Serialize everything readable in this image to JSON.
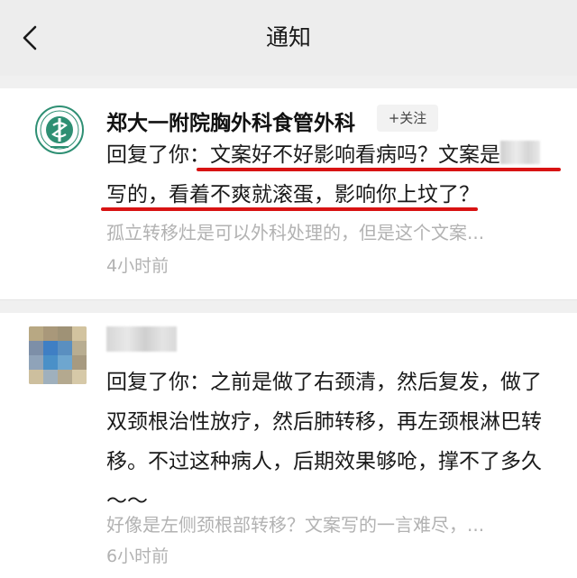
{
  "header": {
    "title": "通知"
  },
  "notifications": [
    {
      "account_name": "郑大一附院胸外科食管外科",
      "follow_label": "+关注",
      "reply_line1_prefix": "回复了你：",
      "reply_line1_text": "文案好不好影响看病吗？文案是",
      "reply_line2_text": "写的，看着不爽就滚蛋，影响你上坟了？",
      "quote": "孤立转移灶是可以外科处理的，但是这个文案...",
      "time": "4小时前"
    },
    {
      "reply_lines": [
        "回复了你：之前是做了右颈清，然后复发，做了",
        "双颈根治性放疗，然后肺转移，再左颈根淋巴转",
        "移。不过这种病人，后期效果够呛，撑不了多久",
        "～～"
      ],
      "quote": "好像是左侧颈根部转移？文案写的一言难尽，...",
      "time": "6小时前"
    }
  ],
  "colors": {
    "header_bg": "#ededed",
    "underline": "#d81313",
    "muted_text": "#b2b2b2",
    "logo_green": "#2e8f73"
  }
}
